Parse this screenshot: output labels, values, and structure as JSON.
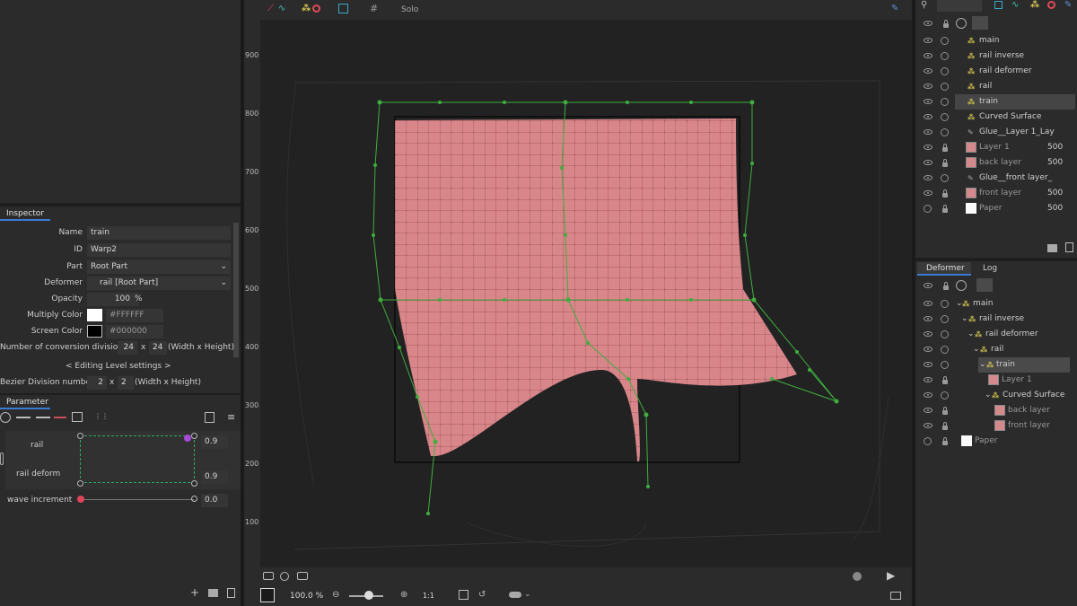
{
  "top_toolbar": {
    "solo_label": "Solo"
  },
  "ruler": {
    "ticks": [
      "900",
      "800",
      "700",
      "600",
      "500",
      "400",
      "300",
      "200",
      "100"
    ]
  },
  "inspector": {
    "tab": "Inspector",
    "name_label": "Name",
    "name_value": "train",
    "id_label": "ID",
    "id_value": "Warp2",
    "part_label": "Part",
    "part_value": "Root Part",
    "deformer_label": "Deformer",
    "deformer_value": "rail  [Root Part]",
    "opacity_label": "Opacity",
    "opacity_value": "100",
    "opacity_unit": "%",
    "multiply_label": "Multiply Color",
    "multiply_value": "#FFFFFF",
    "screen_label": "Screen Color",
    "screen_value": "#000000",
    "conv_label": "Number of conversion divisions",
    "conv_w": "24",
    "conv_x": "x",
    "conv_h": "24",
    "conv_unit": "(Width x Height)",
    "editing_level": "< Editing Level settings >",
    "bezier_label": "Bezier Division number",
    "bezier_w": "2",
    "bezier_x": "x",
    "bezier_h": "2",
    "bezier_unit": "(Width x Height)"
  },
  "parameter": {
    "tab": "Parameter",
    "rail_label": "rail",
    "rail_value": "0.9",
    "rail_deform_label": "rail deform",
    "rail_deform_value": "0.9",
    "wave_label": "wave increment",
    "wave_value": "0.0"
  },
  "viewport_bottom": {
    "zoom_value": "100.0 %",
    "ratio_label": "1:1"
  },
  "parts_panel": {
    "rows": [
      {
        "label": "main",
        "value": ""
      },
      {
        "label": "rail inverse",
        "value": ""
      },
      {
        "label": "rail deformer",
        "value": ""
      },
      {
        "label": "rail",
        "value": ""
      },
      {
        "label": "train",
        "value": ""
      },
      {
        "label": "Curved Surface",
        "value": ""
      },
      {
        "label": "Glue__Layer 1_Lay",
        "value": ""
      },
      {
        "label": "Layer 1",
        "value": "500"
      },
      {
        "label": "back layer",
        "value": "500"
      },
      {
        "label": "Glue__front layer_",
        "value": ""
      },
      {
        "label": "front layer",
        "value": "500"
      },
      {
        "label": "Paper",
        "value": "500"
      }
    ]
  },
  "deformer_panel": {
    "tab_deformer": "Deformer",
    "tab_log": "Log",
    "rows": [
      {
        "label": "main"
      },
      {
        "label": "rail inverse"
      },
      {
        "label": "rail deformer"
      },
      {
        "label": "rail"
      },
      {
        "label": "train"
      },
      {
        "label": "Layer 1"
      },
      {
        "label": "Curved Surface"
      },
      {
        "label": "back layer"
      },
      {
        "label": "front layer"
      },
      {
        "label": "Paper"
      }
    ]
  },
  "colors": {
    "accent_green": "#3fae3f",
    "mesh_pink": "#d9868a",
    "panel": "#2b2b2b",
    "selection": "#454545"
  }
}
